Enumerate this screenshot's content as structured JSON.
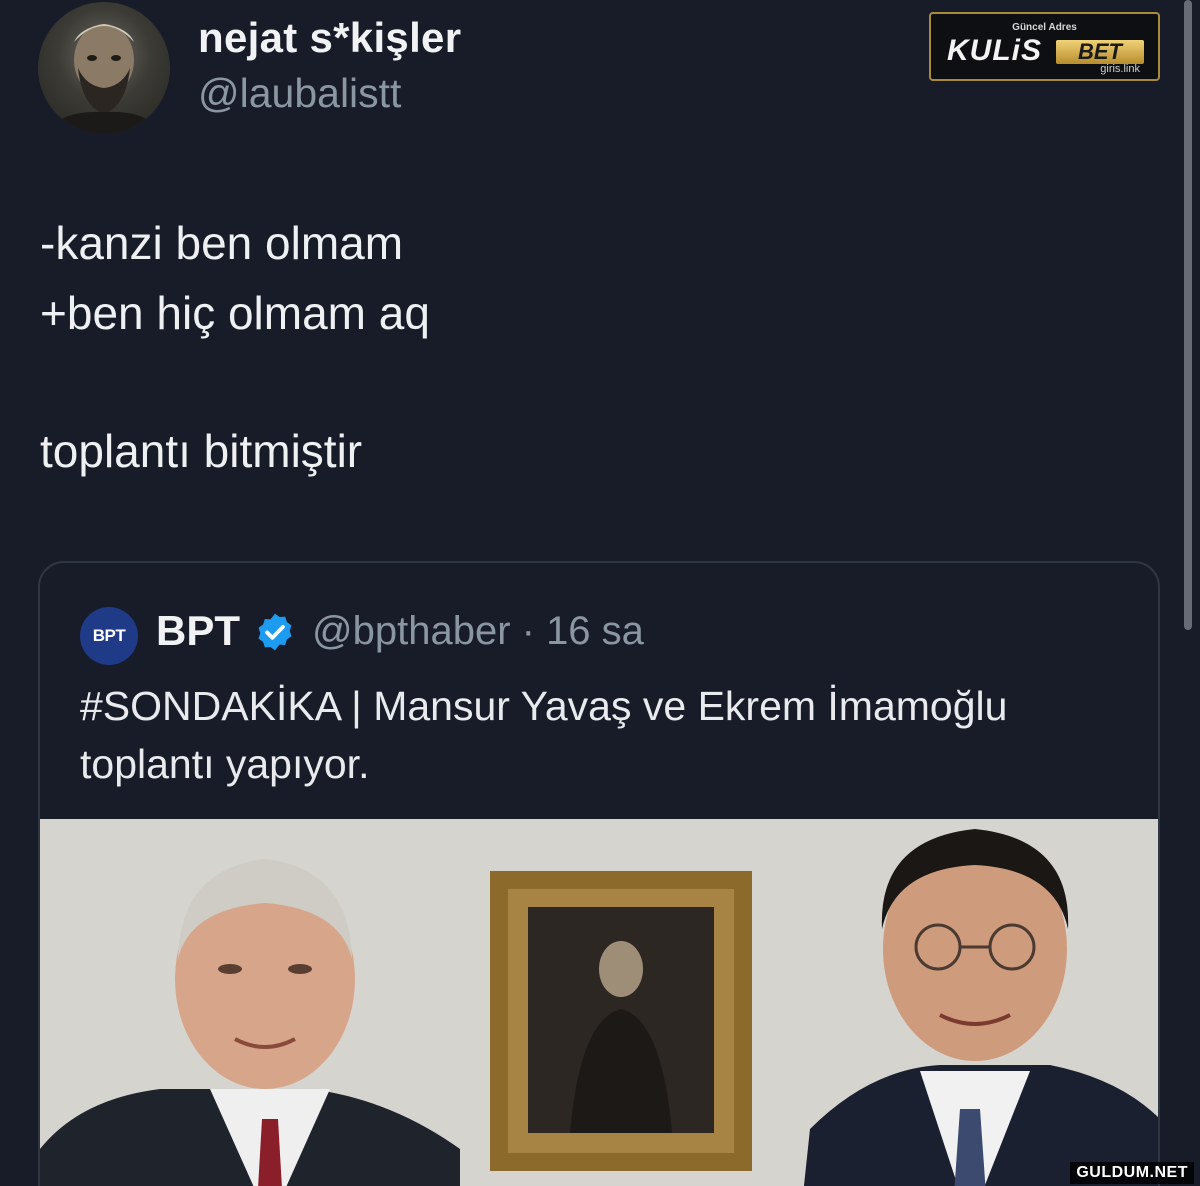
{
  "author": {
    "display_name": "nejat s*kişler",
    "handle": "@laubalistt"
  },
  "sponsor": {
    "top_text": "Güncel Adres",
    "brand": "KULiS",
    "brand_accent": "BET",
    "link": "giris.link"
  },
  "tweet": {
    "lines": [
      "-kanzi ben olmam",
      "+ben hiç olmam aq",
      "toplantı bitmiştir"
    ]
  },
  "quoted_tweet": {
    "avatar_label": "BPT",
    "name": "BPT",
    "handle_time": "@bpthaber · 16 sa",
    "text_lines": [
      "#SONDAKİKA | Mansur Yavaş ve Ekrem İmamoğlu",
      "toplantı yapıyor."
    ],
    "verified_icon": "verified-badge-icon"
  },
  "watermark": "GULDUM.NET",
  "colors": {
    "background": "#171c28",
    "text_primary": "#eef0f2",
    "text_secondary": "#8b96a3",
    "verified_blue": "#1d9bf0",
    "card_border": "#2f3644"
  }
}
